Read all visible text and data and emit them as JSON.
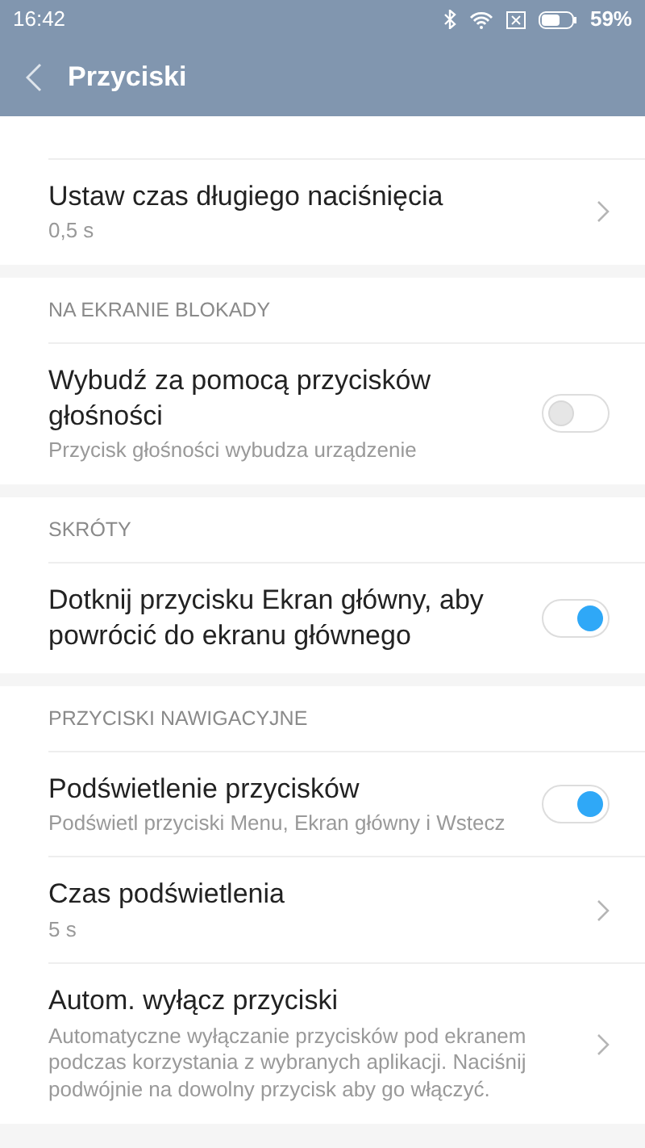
{
  "status_bar": {
    "time": "16:42",
    "battery": "59%"
  },
  "header": {
    "title": "Przyciski"
  },
  "sections": [
    {
      "items": [
        {
          "kind": "nav",
          "title": "Ustaw czas długiego naciśnięcia",
          "subtitle": "0,5 s"
        }
      ]
    },
    {
      "heading": "NA EKRANIE BLOKADY",
      "items": [
        {
          "kind": "toggle",
          "title": "Wybudź za pomocą przycisków głośności",
          "subtitle": "Przycisk głośności wybudza urządzenie",
          "on": false
        }
      ]
    },
    {
      "heading": "SKRÓTY",
      "items": [
        {
          "kind": "toggle",
          "title": "Dotknij przycisku Ekran główny, aby powrócić do ekranu głównego",
          "on": true
        }
      ]
    },
    {
      "heading": "PRZYCISKI NAWIGACYJNE",
      "items": [
        {
          "kind": "toggle",
          "title": "Podświetlenie przycisków",
          "subtitle": "Podświetl przyciski Menu, Ekran główny i Wstecz",
          "on": true
        },
        {
          "kind": "nav",
          "title": "Czas podświetlenia",
          "subtitle": "5 s"
        },
        {
          "kind": "nav",
          "title": "Autom. wyłącz przyciski",
          "subtitle": "Automatyczne wyłączanie przycisków pod ekranem podczas korzystania z wybranych aplikacji. Naciśnij podwójnie na dowolny przycisk aby go włączyć."
        }
      ]
    }
  ]
}
